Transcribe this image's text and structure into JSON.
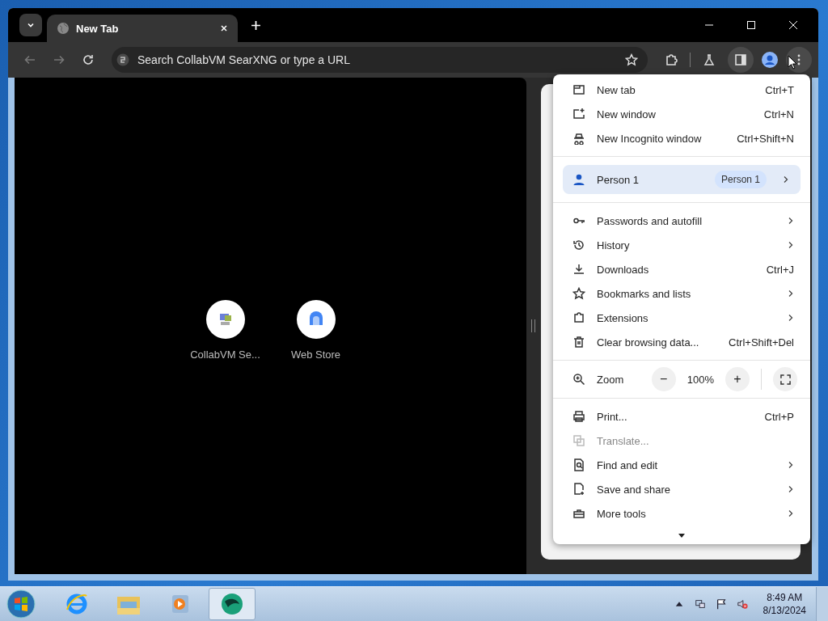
{
  "tab_strip": {
    "tabs": [
      {
        "title": "New Tab",
        "selected": true
      }
    ]
  },
  "toolbar": {
    "back_disabled": true,
    "forward_disabled": true,
    "omnibox": {
      "placeholder": "Search CollabVM SearXNG or type a URL"
    },
    "side_panel_on": true,
    "menu_open": true
  },
  "shortcuts": [
    {
      "title": "CollabVM Se..."
    },
    {
      "title": "Web Store"
    }
  ],
  "menu": {
    "groups": [
      {
        "kind": "items",
        "items": [
          {
            "label": "New tab",
            "shortcut": "Ctrl+T",
            "submenu": false,
            "disabled": false
          },
          {
            "label": "New window",
            "shortcut": "Ctrl+N",
            "submenu": false,
            "disabled": false
          },
          {
            "label": "New Incognito window",
            "shortcut": "Ctrl+Shift+N",
            "submenu": false,
            "disabled": false
          }
        ]
      },
      {
        "kind": "profile",
        "label": "Person 1",
        "badge": "Person 1",
        "selected": true
      },
      {
        "kind": "items",
        "items": [
          {
            "label": "Passwords and autofill",
            "submenu": true,
            "disabled": false
          },
          {
            "label": "History",
            "submenu": true,
            "disabled": false
          },
          {
            "label": "Downloads",
            "shortcut": "Ctrl+J",
            "submenu": false,
            "disabled": false
          },
          {
            "label": "Bookmarks and lists",
            "submenu": true,
            "disabled": false
          },
          {
            "label": "Extensions",
            "submenu": true,
            "disabled": false
          },
          {
            "label": "Clear browsing data...",
            "shortcut": "Ctrl+Shift+Del",
            "submenu": false,
            "disabled": false
          }
        ]
      },
      {
        "kind": "zoom",
        "label": "Zoom",
        "minus": "−",
        "reading": "100%",
        "plus": "+"
      },
      {
        "kind": "items",
        "items": [
          {
            "label": "Print...",
            "shortcut": "Ctrl+P",
            "submenu": false,
            "disabled": false
          },
          {
            "label": "Translate...",
            "submenu": false,
            "disabled": true
          },
          {
            "label": "Find and edit",
            "submenu": true,
            "disabled": false
          },
          {
            "label": "Save and share",
            "submenu": true,
            "disabled": false
          },
          {
            "label": "More tools",
            "submenu": true,
            "disabled": false
          }
        ]
      }
    ]
  },
  "taskbar": {
    "apps": [
      {
        "selected": false
      },
      {
        "selected": false
      },
      {
        "selected": false
      },
      {
        "selected": true
      }
    ],
    "clock": {
      "time": "8:49 AM",
      "date": "8/13/2024"
    }
  }
}
